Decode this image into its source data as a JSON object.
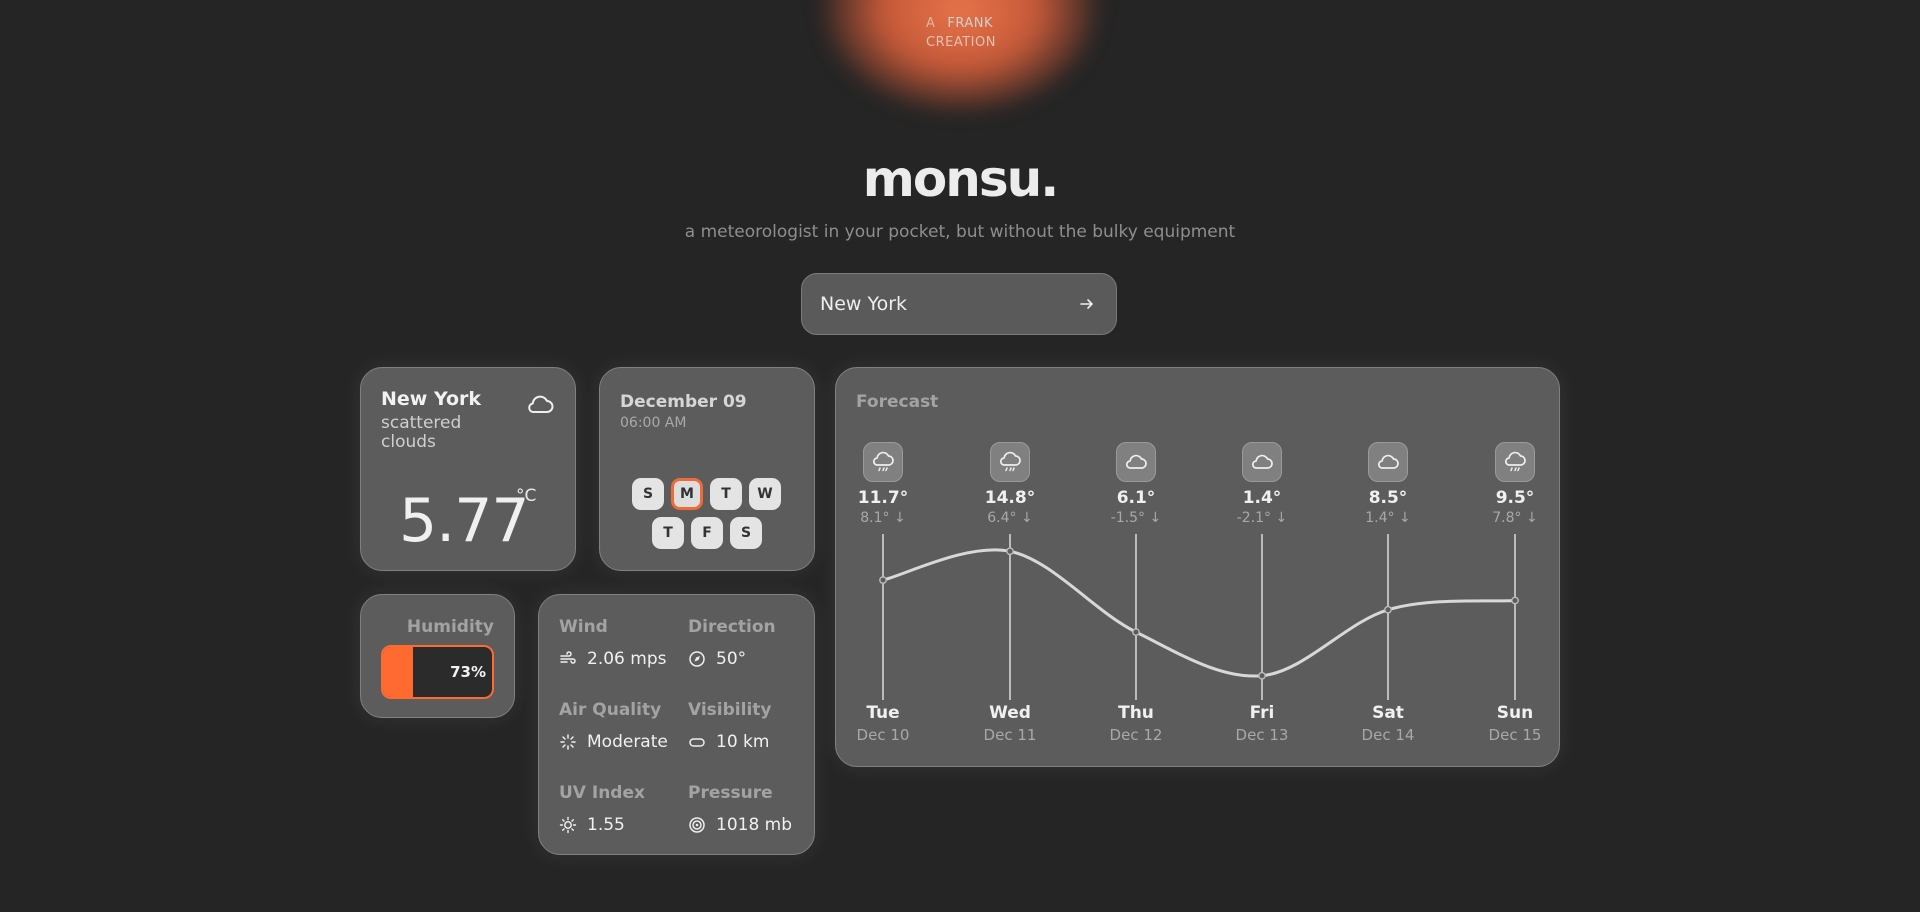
{
  "credit": {
    "a": "A",
    "frank": "FRANK",
    "creation": "CREATION"
  },
  "app": {
    "title": "monsu.",
    "tagline": "a meteorologist in your pocket, but without the bulky equipment"
  },
  "search": {
    "value": "New York",
    "icon": "arrow-right-icon"
  },
  "current": {
    "city": "New York",
    "description": "scattered clouds",
    "temperature": "5.77",
    "unit": "°C",
    "icon": "cloud-icon"
  },
  "date": {
    "day": "December 09",
    "time": "06:00 AM",
    "weekdays": [
      "S",
      "M",
      "T",
      "W",
      "T",
      "F",
      "S"
    ],
    "active_index": 1
  },
  "humidity": {
    "label": "Humidity",
    "value": "73%",
    "fraction": 0.73
  },
  "stats": {
    "wind": {
      "label": "Wind",
      "value": "2.06 mps",
      "icon": "wind-icon"
    },
    "direction": {
      "label": "Direction",
      "value": "50°",
      "icon": "compass-icon"
    },
    "air_quality": {
      "label": "Air Quality",
      "value": "Moderate",
      "icon": "loader-icon"
    },
    "visibility": {
      "label": "Visibility",
      "value": "10 km",
      "icon": "glasses-icon"
    },
    "uv_index": {
      "label": "UV Index",
      "value": "1.55",
      "icon": "sun-icon"
    },
    "pressure": {
      "label": "Pressure",
      "value": "1018 mb",
      "icon": "target-icon"
    }
  },
  "forecast": {
    "title": "Forecast",
    "days": [
      {
        "day": "Tue",
        "date": "Dec 10",
        "high": "11.7°",
        "low": "8.1°",
        "icon": "cloud-rain-icon"
      },
      {
        "day": "Wed",
        "date": "Dec 11",
        "high": "14.8°",
        "low": "6.4°",
        "icon": "cloud-rain-icon"
      },
      {
        "day": "Thu",
        "date": "Dec 12",
        "high": "6.1°",
        "low": "-1.5°",
        "icon": "cloud-icon"
      },
      {
        "day": "Fri",
        "date": "Dec 13",
        "high": "1.4°",
        "low": "-2.1°",
        "icon": "cloud-icon"
      },
      {
        "day": "Sat",
        "date": "Dec 14",
        "high": "8.5°",
        "low": "1.4°",
        "icon": "cloud-icon"
      },
      {
        "day": "Sun",
        "date": "Dec 15",
        "high": "9.5°",
        "low": "7.8°",
        "icon": "cloud-rain-icon"
      }
    ]
  },
  "chart_data": {
    "type": "line",
    "categories": [
      "Tue",
      "Wed",
      "Thu",
      "Fri",
      "Sat",
      "Sun"
    ],
    "series": [
      {
        "values": [
          11.7,
          14.8,
          6.1,
          1.4,
          8.5,
          9.5
        ]
      }
    ],
    "grid": true
  }
}
